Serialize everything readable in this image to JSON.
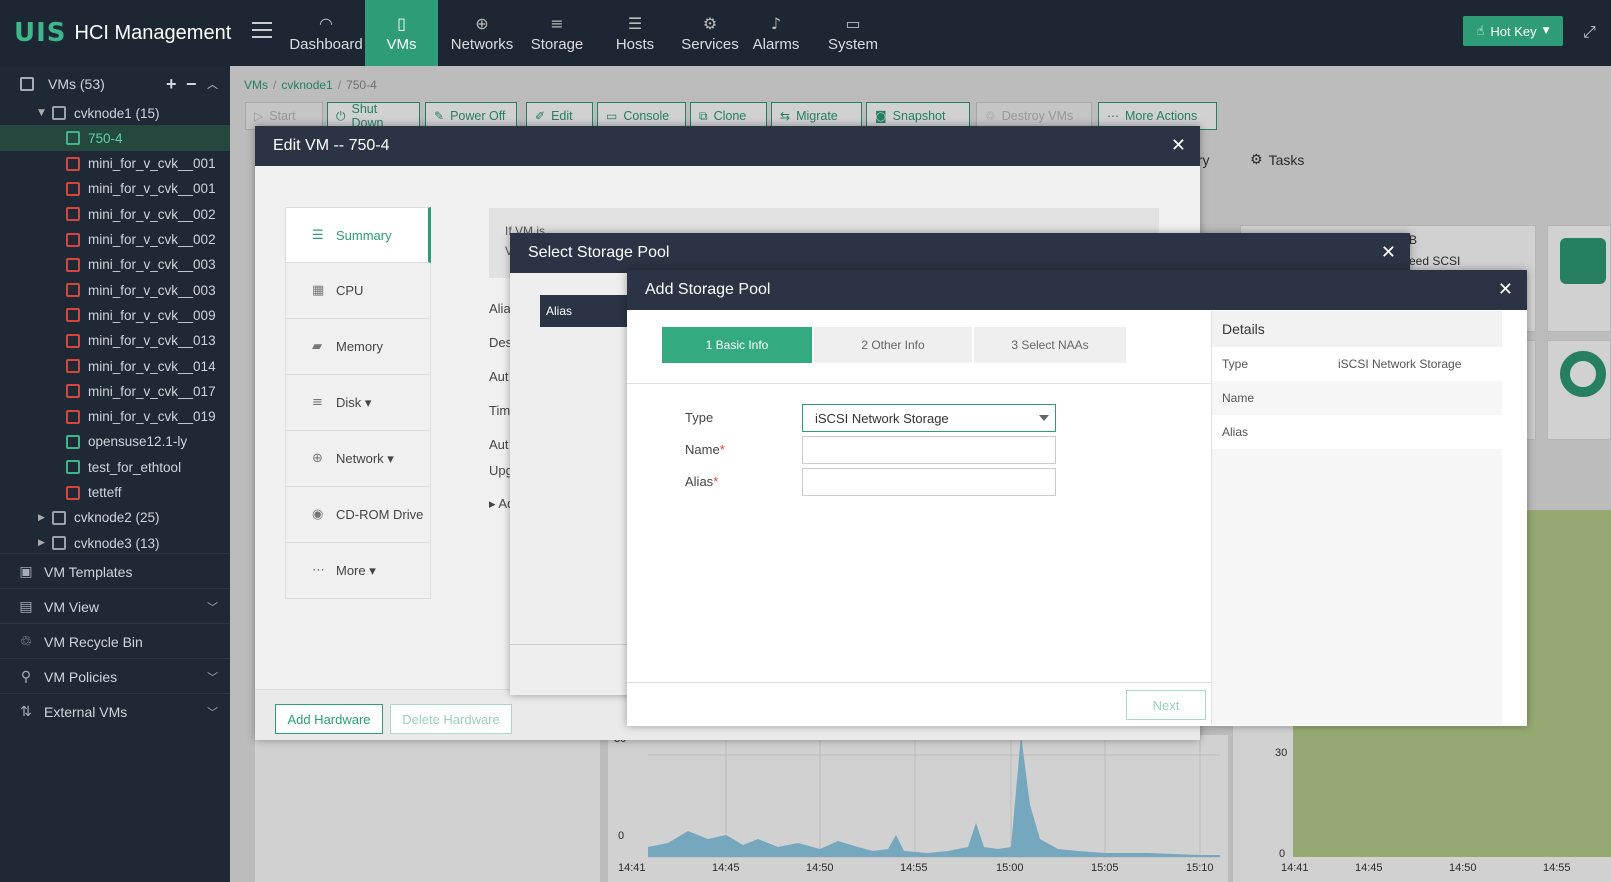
{
  "app": {
    "logo_mark": "UIS",
    "title": "HCI Management"
  },
  "nav": [
    {
      "label": "Dashboard",
      "icon": "gauge-icon",
      "glyph": "◠"
    },
    {
      "label": "VMs",
      "icon": "vm-icon",
      "glyph": "▯",
      "active": true
    },
    {
      "label": "Networks",
      "icon": "globe-icon",
      "glyph": "⊕"
    },
    {
      "label": "Storage",
      "icon": "database-icon",
      "glyph": "≡"
    },
    {
      "label": "Hosts",
      "icon": "server-icon",
      "glyph": "☰"
    },
    {
      "label": "Services",
      "icon": "gear-icon",
      "glyph": "⚙"
    },
    {
      "label": "Alarms",
      "icon": "bell-icon",
      "glyph": "♪"
    },
    {
      "label": "System",
      "icon": "monitor-icon",
      "glyph": "▭"
    }
  ],
  "hotkey": {
    "label": "Hot Key"
  },
  "sidebar": {
    "vms_label": "VMs (53)",
    "tree": [
      {
        "label": "cvknode1 (15)",
        "kind": "host",
        "level": 1,
        "expanded": true
      },
      {
        "label": "750-4",
        "kind": "green",
        "level": 2,
        "selected": true
      },
      {
        "label": "mini_for_v_cvk__001",
        "kind": "red",
        "level": 2
      },
      {
        "label": "mini_for_v_cvk__001",
        "kind": "red",
        "level": 2
      },
      {
        "label": "mini_for_v_cvk__002",
        "kind": "red",
        "level": 2
      },
      {
        "label": "mini_for_v_cvk__002",
        "kind": "red",
        "level": 2
      },
      {
        "label": "mini_for_v_cvk__003",
        "kind": "red",
        "level": 2
      },
      {
        "label": "mini_for_v_cvk__003",
        "kind": "red",
        "level": 2
      },
      {
        "label": "mini_for_v_cvk__009",
        "kind": "red",
        "level": 2
      },
      {
        "label": "mini_for_v_cvk__013",
        "kind": "red",
        "level": 2
      },
      {
        "label": "mini_for_v_cvk__014",
        "kind": "red",
        "level": 2
      },
      {
        "label": "mini_for_v_cvk__017",
        "kind": "red",
        "level": 2
      },
      {
        "label": "mini_for_v_cvk__019",
        "kind": "red",
        "level": 2
      },
      {
        "label": "opensuse12.1-ly",
        "kind": "green",
        "level": 2
      },
      {
        "label": "test_for_ethtool",
        "kind": "green",
        "level": 2
      },
      {
        "label": "tetteff",
        "kind": "red",
        "level": 2
      },
      {
        "label": "cvknode2 (25)",
        "kind": "host",
        "level": 1,
        "expanded": false
      },
      {
        "label": "cvknode3 (13)",
        "kind": "host",
        "level": 1,
        "expanded": false
      }
    ],
    "sections": [
      {
        "label": "VM Templates",
        "icon": "template-icon",
        "glyph": "▣",
        "chevron": false
      },
      {
        "label": "VM View",
        "icon": "folder-icon",
        "glyph": "▤",
        "chevron": true
      },
      {
        "label": "VM Recycle Bin",
        "icon": "trash-icon",
        "glyph": "♲",
        "chevron": false
      },
      {
        "label": "VM Policies",
        "icon": "policy-icon",
        "glyph": "⚲",
        "chevron": true
      },
      {
        "label": "External VMs",
        "icon": "external-icon",
        "glyph": "⇅",
        "chevron": true
      }
    ]
  },
  "breadcrumb": [
    "VMs",
    "cvknode1",
    "750-4"
  ],
  "toolbar": [
    {
      "label": "Start",
      "glyph": "▷",
      "disabled": true
    },
    {
      "label": "Shut Down",
      "glyph": "⏻"
    },
    {
      "label": "Power Off",
      "glyph": "✎"
    },
    {
      "label": "Edit",
      "glyph": "✐"
    },
    {
      "label": "Console",
      "glyph": "▭"
    },
    {
      "label": "Clone",
      "glyph": "⧉"
    },
    {
      "label": "Migrate",
      "glyph": "⇆"
    },
    {
      "label": "Snapshot",
      "glyph": "◙"
    },
    {
      "label": "Destroy VMs",
      "glyph": "♲",
      "disabled": true
    },
    {
      "label": "More Actions",
      "glyph": "⋯"
    }
  ],
  "bg_tabs": {
    "partial": "ory",
    "tasks": "Tasks"
  },
  "bg_texts": {
    "scsi": "eed SCSI",
    "b": "B"
  },
  "edit_vm": {
    "title": "Edit VM -- 750-4",
    "menu": [
      {
        "label": "Summary",
        "glyph": "☰",
        "active": true
      },
      {
        "label": "CPU",
        "glyph": "▦"
      },
      {
        "label": "Memory",
        "glyph": "▰"
      },
      {
        "label": "Disk ▾",
        "glyph": "≡"
      },
      {
        "label": "Network ▾",
        "glyph": "⊕"
      },
      {
        "label": "CD-ROM Drive",
        "glyph": "◉"
      },
      {
        "label": "More ▾",
        "glyph": "⋯"
      }
    ],
    "notice_line1": "If VM is ... ",
    "notice_line2": "V",
    "field_fragments": [
      "Alia",
      "Des",
      "Aut",
      "Tim",
      "Aut",
      "Upg",
      "▸ Ad"
    ],
    "add_hardware": "Add Hardware",
    "delete_hardware": "Delete Hardware"
  },
  "select_pool": {
    "title": "Select Storage Pool",
    "alias_header": "Alias"
  },
  "add_pool": {
    "title": "Add Storage Pool",
    "steps": [
      "1 Basic Info",
      "2 Other Info",
      "3 Select NAAs"
    ],
    "fields": [
      {
        "label": "Type",
        "required": false,
        "value": "iSCSI Network Storage",
        "select": true
      },
      {
        "label": "Name",
        "required": true,
        "value": ""
      },
      {
        "label": "Alias",
        "required": true,
        "value": ""
      }
    ],
    "next": "Next",
    "details_title": "Details",
    "details": [
      {
        "key": "Type",
        "value": "iSCSI Network Storage"
      },
      {
        "key": "Name",
        "value": ""
      },
      {
        "key": "Alias",
        "value": ""
      }
    ]
  },
  "chart1": {
    "y_labels": [
      "30",
      "0"
    ],
    "x_labels": [
      "14:41",
      "14:45",
      "14:50",
      "14:55",
      "15:00",
      "15:05",
      "15:10"
    ]
  },
  "chart2": {
    "y_labels": [
      "30",
      "0"
    ],
    "x_labels": [
      "14:41",
      "14:45",
      "14:50",
      "14:55"
    ]
  }
}
